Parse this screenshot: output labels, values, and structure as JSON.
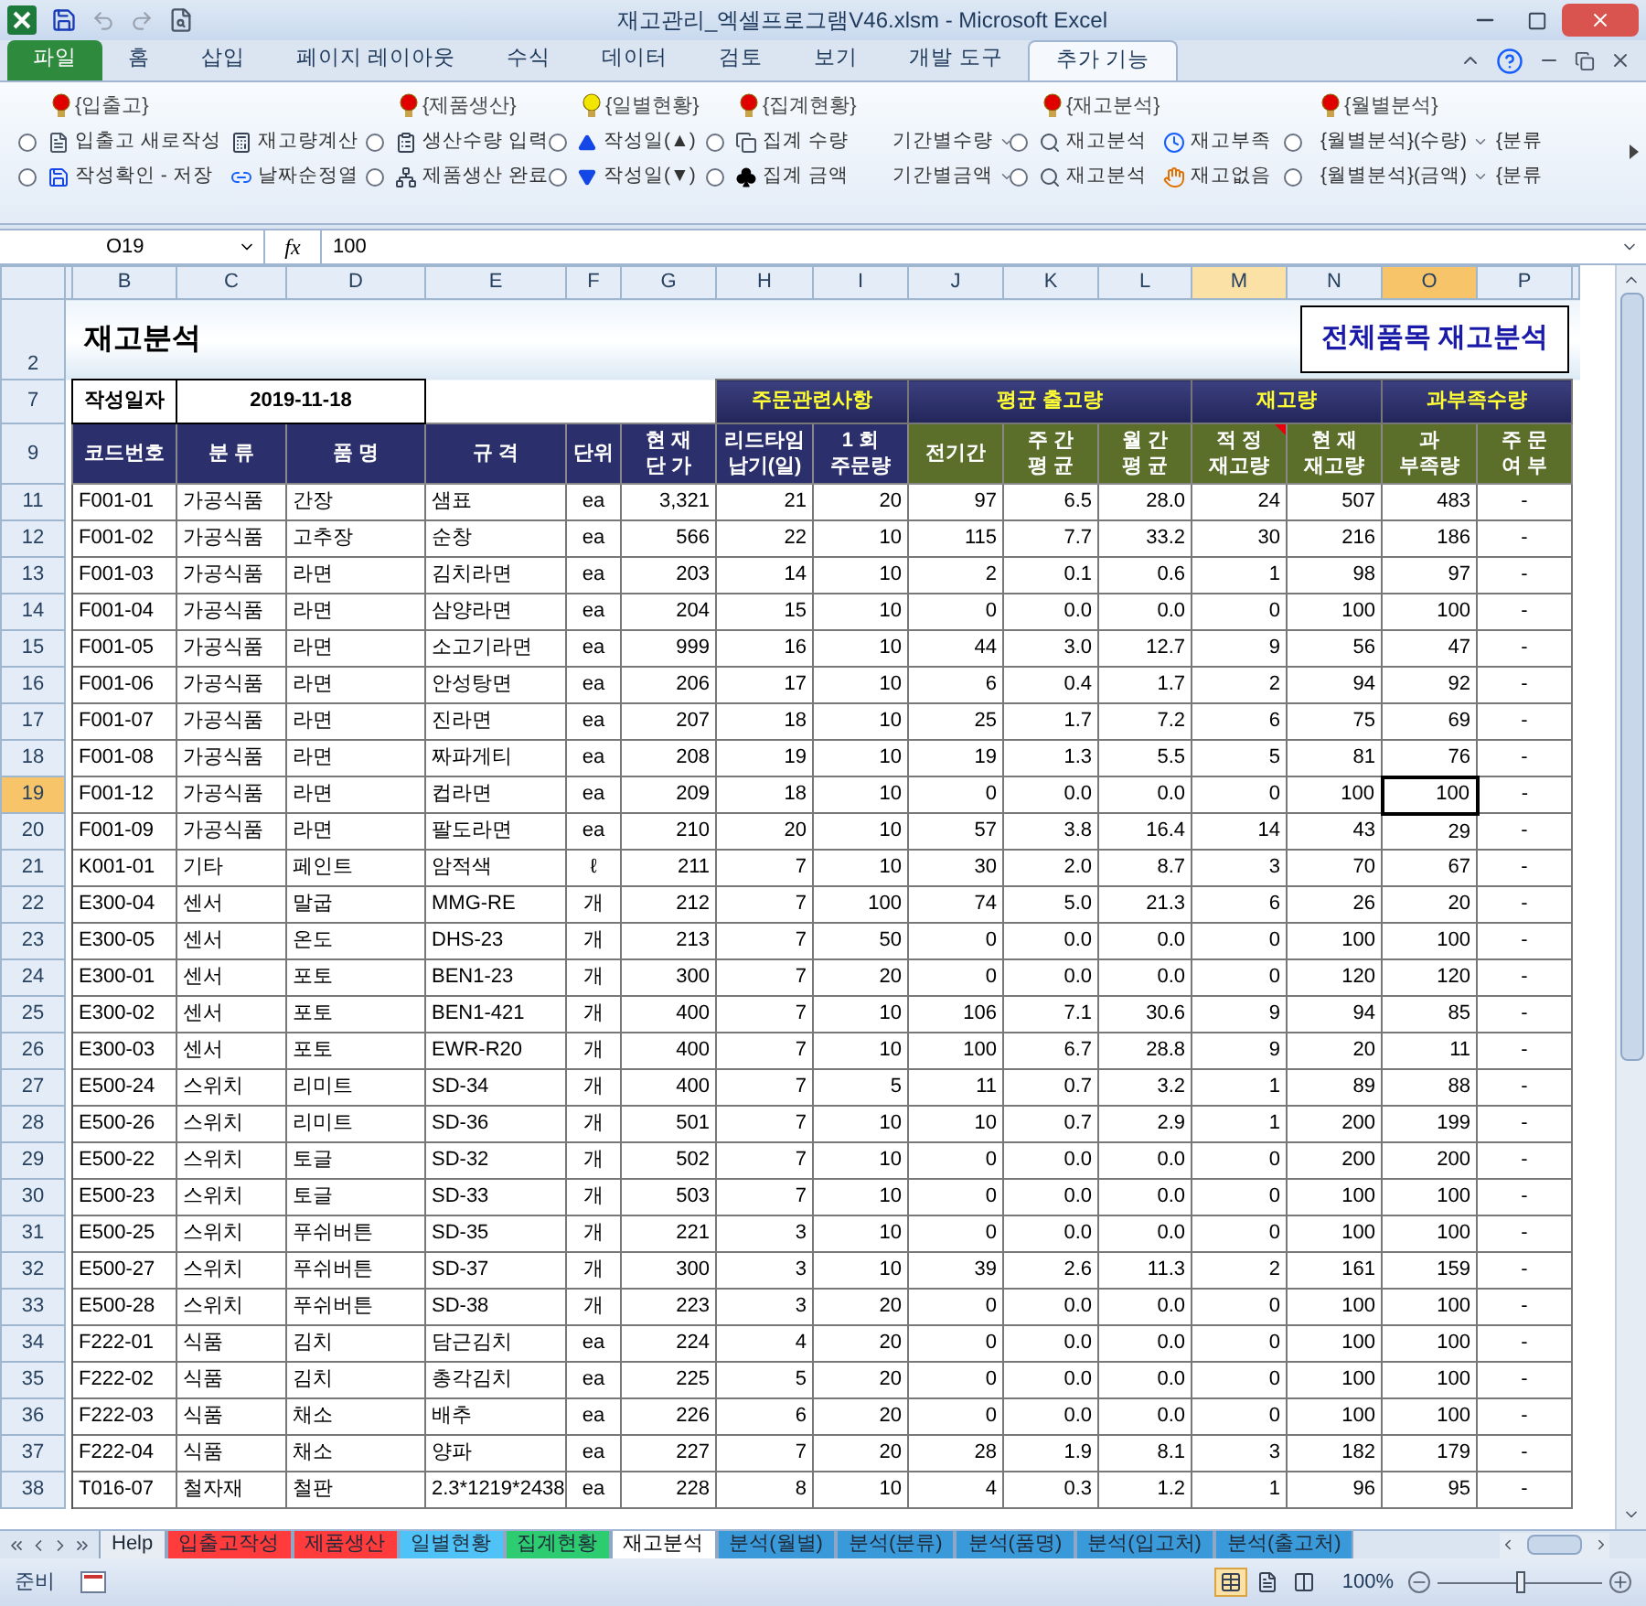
{
  "window": {
    "title": "재고관리_엑셀프로그램V46.xlsm - Microsoft Excel"
  },
  "menu_tabs": [
    {
      "label": "파일",
      "kind": "file",
      "selected": false
    },
    {
      "label": "홈",
      "kind": "tab",
      "selected": false
    },
    {
      "label": "삽입",
      "kind": "tab",
      "selected": false
    },
    {
      "label": "페이지 레이아웃",
      "kind": "tab",
      "selected": false
    },
    {
      "label": "수식",
      "kind": "tab",
      "selected": false
    },
    {
      "label": "데이터",
      "kind": "tab",
      "selected": false
    },
    {
      "label": "검토",
      "kind": "tab",
      "selected": false
    },
    {
      "label": "보기",
      "kind": "tab",
      "selected": false
    },
    {
      "label": "개발 도구",
      "kind": "tab",
      "selected": false
    },
    {
      "label": "추가 기능",
      "kind": "tab",
      "selected": true
    }
  ],
  "ribbon": {
    "columns": [
      {
        "items": [
          {
            "kind": "radio",
            "selected": false
          },
          {
            "kind": "radio",
            "selected": false
          }
        ]
      },
      {
        "header": {
          "label": "{입출고}",
          "color": "#e00000"
        },
        "items": [
          {
            "kind": "button",
            "label": "입출고 새로작성"
          },
          {
            "kind": "button",
            "label": "작성확인 - 저장"
          }
        ]
      },
      {
        "items": [
          {
            "kind": "button",
            "label": "재고량계산"
          },
          {
            "kind": "button",
            "label": "날짜순정열"
          }
        ]
      },
      {
        "items": [
          {
            "kind": "radio",
            "selected": false
          },
          {
            "kind": "radio",
            "selected": false
          }
        ]
      },
      {
        "header": {
          "label": "{제품생산}",
          "color": "#e00000"
        },
        "items": [
          {
            "kind": "button",
            "label": "생산수량 입력"
          },
          {
            "kind": "button",
            "label": "제품생산 완료"
          }
        ]
      },
      {
        "items": [
          {
            "kind": "radio",
            "selected": false
          },
          {
            "kind": "radio",
            "selected": false
          }
        ]
      },
      {
        "header": {
          "label": "{일별현황}",
          "color": "#f2e600"
        },
        "items": [
          {
            "kind": "button",
            "label": "작성일(▲)"
          },
          {
            "kind": "button",
            "label": "작성일(▼)"
          }
        ]
      },
      {
        "items": [
          {
            "kind": "radio",
            "selected": false
          },
          {
            "kind": "radio",
            "selected": false
          }
        ]
      },
      {
        "header": {
          "label": "{집계현황}",
          "color": "#e00000"
        },
        "items": [
          {
            "kind": "button",
            "label": "집계 수량"
          },
          {
            "kind": "button",
            "label": "집계 금액"
          }
        ]
      },
      {
        "items": [
          {
            "kind": "dropdown",
            "label": "기간별수량"
          },
          {
            "kind": "dropdown",
            "label": "기간별금액"
          }
        ]
      },
      {
        "items": [
          {
            "kind": "radio",
            "selected": false
          },
          {
            "kind": "radio",
            "selected": false
          }
        ]
      },
      {
        "header": {
          "label": "{재고분석}",
          "color": "#e00000"
        },
        "items": [
          {
            "kind": "button",
            "label": "재고분석"
          },
          {
            "kind": "button",
            "label": "재고분석"
          }
        ]
      },
      {
        "items": [
          {
            "kind": "button",
            "label": "재고부족"
          },
          {
            "kind": "button",
            "label": "재고없음"
          }
        ]
      },
      {
        "items": [
          {
            "kind": "radio",
            "selected": false
          },
          {
            "kind": "radio",
            "selected": false
          }
        ]
      },
      {
        "header": {
          "label": "{월별분석}",
          "color": "#e00000"
        },
        "items": [
          {
            "kind": "dropdown",
            "label": "{월별분석}(수량)"
          },
          {
            "kind": "dropdown",
            "label": "{월별분석}(금액)"
          }
        ]
      },
      {
        "items": [
          {
            "kind": "text",
            "label": "{분류"
          },
          {
            "kind": "text",
            "label": "{분류"
          }
        ]
      }
    ]
  },
  "formula_bar": {
    "name_box": "O19",
    "function_label": "fx",
    "value": "100"
  },
  "sheet": {
    "column_headers": [
      {
        "label": "B",
        "selected": false,
        "highlighted": false
      },
      {
        "label": "C",
        "selected": false,
        "highlighted": false
      },
      {
        "label": "D",
        "selected": false,
        "highlighted": false
      },
      {
        "label": "E",
        "selected": false,
        "highlighted": false
      },
      {
        "label": "F",
        "selected": false,
        "highlighted": false
      },
      {
        "label": "G",
        "selected": false,
        "highlighted": false
      },
      {
        "label": "H",
        "selected": false,
        "highlighted": false
      },
      {
        "label": "I",
        "selected": false,
        "highlighted": false
      },
      {
        "label": "J",
        "selected": false,
        "highlighted": false
      },
      {
        "label": "K",
        "selected": false,
        "highlighted": false
      },
      {
        "label": "L",
        "selected": false,
        "highlighted": false
      },
      {
        "label": "M",
        "selected": false,
        "highlighted": true
      },
      {
        "label": "N",
        "selected": false,
        "highlighted": false
      },
      {
        "label": "O",
        "selected": true,
        "highlighted": false
      },
      {
        "label": "P",
        "selected": false,
        "highlighted": false
      }
    ],
    "title_row": {
      "number": "2",
      "title": "재고분석",
      "report_title": "전체품목 재고분석"
    },
    "info_row": {
      "number": "7",
      "date_label": "작성일자",
      "date": "2019-11-18",
      "bands": [
        {
          "label": "주문관련사항"
        },
        {
          "label": "평균 출고량"
        },
        {
          "label": "재고량"
        },
        {
          "label": "과부족수량"
        }
      ]
    },
    "header_row": {
      "number": "9",
      "titles": [
        {
          "label": "코드번호",
          "kind": "item",
          "comment": false
        },
        {
          "label": "분 류",
          "kind": "item",
          "comment": false
        },
        {
          "label": "품 명",
          "kind": "item",
          "comment": false
        },
        {
          "label": "규 격",
          "kind": "item",
          "comment": false
        },
        {
          "label": "단위",
          "kind": "item",
          "comment": false
        },
        {
          "label": "현 재\n단 가",
          "kind": "item",
          "comment": false
        },
        {
          "label": "리드타임\n납기(일)",
          "kind": "item",
          "comment": false
        },
        {
          "label": "1 회\n주문량",
          "kind": "item",
          "comment": false
        },
        {
          "label": "전기간",
          "kind": "analysis",
          "comment": false
        },
        {
          "label": "주 간\n평 균",
          "kind": "analysis",
          "comment": false
        },
        {
          "label": "월 간\n평 균",
          "kind": "analysis",
          "comment": false
        },
        {
          "label": "적 정\n재고량",
          "kind": "analysis",
          "comment": true
        },
        {
          "label": "현 재\n재고량",
          "kind": "analysis",
          "comment": false
        },
        {
          "label": "과\n부족량",
          "kind": "analysis",
          "comment": false
        },
        {
          "label": "주 문\n여 부",
          "kind": "analysis",
          "comment": false
        }
      ]
    },
    "rows": [
      {
        "number": "11",
        "selected": false,
        "cells": [
          "F001-01",
          "가공식품",
          "간장",
          "샘표",
          "ea",
          "3,321",
          "21",
          "20",
          "97",
          "6.5",
          "28.0",
          "24",
          "507",
          "483",
          "-"
        ]
      },
      {
        "number": "12",
        "selected": false,
        "cells": [
          "F001-02",
          "가공식품",
          "고추장",
          "순창",
          "ea",
          "566",
          "22",
          "10",
          "115",
          "7.7",
          "33.2",
          "30",
          "216",
          "186",
          "-"
        ]
      },
      {
        "number": "13",
        "selected": false,
        "cells": [
          "F001-03",
          "가공식품",
          "라면",
          "김치라면",
          "ea",
          "203",
          "14",
          "10",
          "2",
          "0.1",
          "0.6",
          "1",
          "98",
          "97",
          "-"
        ]
      },
      {
        "number": "14",
        "selected": false,
        "cells": [
          "F001-04",
          "가공식품",
          "라면",
          "삼양라면",
          "ea",
          "204",
          "15",
          "10",
          "0",
          "0.0",
          "0.0",
          "0",
          "100",
          "100",
          "-"
        ]
      },
      {
        "number": "15",
        "selected": false,
        "cells": [
          "F001-05",
          "가공식품",
          "라면",
          "소고기라면",
          "ea",
          "999",
          "16",
          "10",
          "44",
          "3.0",
          "12.7",
          "9",
          "56",
          "47",
          "-"
        ]
      },
      {
        "number": "16",
        "selected": false,
        "cells": [
          "F001-06",
          "가공식품",
          "라면",
          "안성탕면",
          "ea",
          "206",
          "17",
          "10",
          "6",
          "0.4",
          "1.7",
          "2",
          "94",
          "92",
          "-"
        ]
      },
      {
        "number": "17",
        "selected": false,
        "cells": [
          "F001-07",
          "가공식품",
          "라면",
          "진라면",
          "ea",
          "207",
          "18",
          "10",
          "25",
          "1.7",
          "7.2",
          "6",
          "75",
          "69",
          "-"
        ]
      },
      {
        "number": "18",
        "selected": false,
        "cells": [
          "F001-08",
          "가공식품",
          "라면",
          "짜파게티",
          "ea",
          "208",
          "19",
          "10",
          "19",
          "1.3",
          "5.5",
          "5",
          "81",
          "76",
          "-"
        ]
      },
      {
        "number": "19",
        "selected": true,
        "cells": [
          "F001-12",
          "가공식품",
          "라면",
          "컵라면",
          "ea",
          "209",
          "18",
          "10",
          "0",
          "0.0",
          "0.0",
          "0",
          "100",
          "100",
          "-"
        ]
      },
      {
        "number": "20",
        "selected": false,
        "cells": [
          "F001-09",
          "가공식품",
          "라면",
          "팔도라면",
          "ea",
          "210",
          "20",
          "10",
          "57",
          "3.8",
          "16.4",
          "14",
          "43",
          "29",
          "-"
        ]
      },
      {
        "number": "21",
        "selected": false,
        "cells": [
          "K001-01",
          "기타",
          "페인트",
          "암적색",
          "ℓ",
          "211",
          "7",
          "10",
          "30",
          "2.0",
          "8.7",
          "3",
          "70",
          "67",
          "-"
        ]
      },
      {
        "number": "22",
        "selected": false,
        "cells": [
          "E300-04",
          "센서",
          "말굽",
          "MMG-RE",
          "개",
          "212",
          "7",
          "100",
          "74",
          "5.0",
          "21.3",
          "6",
          "26",
          "20",
          "-"
        ]
      },
      {
        "number": "23",
        "selected": false,
        "cells": [
          "E300-05",
          "센서",
          "온도",
          "DHS-23",
          "개",
          "213",
          "7",
          "50",
          "0",
          "0.0",
          "0.0",
          "0",
          "100",
          "100",
          "-"
        ]
      },
      {
        "number": "24",
        "selected": false,
        "cells": [
          "E300-01",
          "센서",
          "포토",
          "BEN1-23",
          "개",
          "300",
          "7",
          "20",
          "0",
          "0.0",
          "0.0",
          "0",
          "120",
          "120",
          "-"
        ]
      },
      {
        "number": "25",
        "selected": false,
        "cells": [
          "E300-02",
          "센서",
          "포토",
          "BEN1-421",
          "개",
          "400",
          "7",
          "10",
          "106",
          "7.1",
          "30.6",
          "9",
          "94",
          "85",
          "-"
        ]
      },
      {
        "number": "26",
        "selected": false,
        "cells": [
          "E300-03",
          "센서",
          "포토",
          "EWR-R20",
          "개",
          "400",
          "7",
          "10",
          "100",
          "6.7",
          "28.8",
          "9",
          "20",
          "11",
          "-"
        ]
      },
      {
        "number": "27",
        "selected": false,
        "cells": [
          "E500-24",
          "스위치",
          "리미트",
          "SD-34",
          "개",
          "400",
          "7",
          "5",
          "11",
          "0.7",
          "3.2",
          "1",
          "89",
          "88",
          "-"
        ]
      },
      {
        "number": "28",
        "selected": false,
        "cells": [
          "E500-26",
          "스위치",
          "리미트",
          "SD-36",
          "개",
          "501",
          "7",
          "10",
          "10",
          "0.7",
          "2.9",
          "1",
          "200",
          "199",
          "-"
        ]
      },
      {
        "number": "29",
        "selected": false,
        "cells": [
          "E500-22",
          "스위치",
          "토글",
          "SD-32",
          "개",
          "502",
          "7",
          "10",
          "0",
          "0.0",
          "0.0",
          "0",
          "200",
          "200",
          "-"
        ]
      },
      {
        "number": "30",
        "selected": false,
        "cells": [
          "E500-23",
          "스위치",
          "토글",
          "SD-33",
          "개",
          "503",
          "7",
          "10",
          "0",
          "0.0",
          "0.0",
          "0",
          "100",
          "100",
          "-"
        ]
      },
      {
        "number": "31",
        "selected": false,
        "cells": [
          "E500-25",
          "스위치",
          "푸쉬버튼",
          "SD-35",
          "개",
          "221",
          "3",
          "10",
          "0",
          "0.0",
          "0.0",
          "0",
          "100",
          "100",
          "-"
        ]
      },
      {
        "number": "32",
        "selected": false,
        "cells": [
          "E500-27",
          "스위치",
          "푸쉬버튼",
          "SD-37",
          "개",
          "300",
          "3",
          "10",
          "39",
          "2.6",
          "11.3",
          "2",
          "161",
          "159",
          "-"
        ]
      },
      {
        "number": "33",
        "selected": false,
        "cells": [
          "E500-28",
          "스위치",
          "푸쉬버튼",
          "SD-38",
          "개",
          "223",
          "3",
          "20",
          "0",
          "0.0",
          "0.0",
          "0",
          "100",
          "100",
          "-"
        ]
      },
      {
        "number": "34",
        "selected": false,
        "cells": [
          "F222-01",
          "식품",
          "김치",
          "담근김치",
          "ea",
          "224",
          "4",
          "20",
          "0",
          "0.0",
          "0.0",
          "0",
          "100",
          "100",
          "-"
        ]
      },
      {
        "number": "35",
        "selected": false,
        "cells": [
          "F222-02",
          "식품",
          "김치",
          "총각김치",
          "ea",
          "225",
          "5",
          "20",
          "0",
          "0.0",
          "0.0",
          "0",
          "100",
          "100",
          "-"
        ]
      },
      {
        "number": "36",
        "selected": false,
        "cells": [
          "F222-03",
          "식품",
          "채소",
          "배추",
          "ea",
          "226",
          "6",
          "20",
          "0",
          "0.0",
          "0.0",
          "0",
          "100",
          "100",
          "-"
        ]
      },
      {
        "number": "37",
        "selected": false,
        "cells": [
          "F222-04",
          "식품",
          "채소",
          "양파",
          "ea",
          "227",
          "7",
          "20",
          "28",
          "1.9",
          "8.1",
          "3",
          "182",
          "179",
          "-"
        ]
      },
      {
        "number": "38",
        "selected": false,
        "cells": [
          "T016-07",
          "철자재",
          "철판",
          "2.3*1219*2438",
          "ea",
          "228",
          "8",
          "10",
          "4",
          "0.3",
          "1.2",
          "1",
          "96",
          "95",
          "-"
        ]
      }
    ]
  },
  "sheet_tabs": [
    {
      "label": "Help",
      "color": "#e8edf4",
      "selected": false
    },
    {
      "label": "입출고작성",
      "color": "#ff3b3b",
      "selected": false
    },
    {
      "label": "제품생산",
      "color": "#ff3b3b",
      "selected": false
    },
    {
      "label": "일별현황",
      "color": "#4fc3f7",
      "selected": false
    },
    {
      "label": "집계현황",
      "color": "#2ecc71",
      "selected": false
    },
    {
      "label": "재고분석",
      "color": "#ffffff",
      "selected": true
    },
    {
      "label": "분석(월별)",
      "color": "#3a9ad9",
      "selected": false
    },
    {
      "label": "분석(분류)",
      "color": "#3a9ad9",
      "selected": false
    },
    {
      "label": "분석(품명)",
      "color": "#3a9ad9",
      "selected": false
    },
    {
      "label": "분석(입고처)",
      "color": "#3a9ad9",
      "selected": false
    },
    {
      "label": "분석(출고처)",
      "color": "#3a9ad9",
      "selected": false
    }
  ],
  "status_bar": {
    "status": "준비",
    "views": [
      {
        "selected": true
      },
      {
        "selected": false
      },
      {
        "selected": false
      }
    ],
    "zoom": "100%",
    "zoom_slider": {
      "level": 0.5
    }
  }
}
